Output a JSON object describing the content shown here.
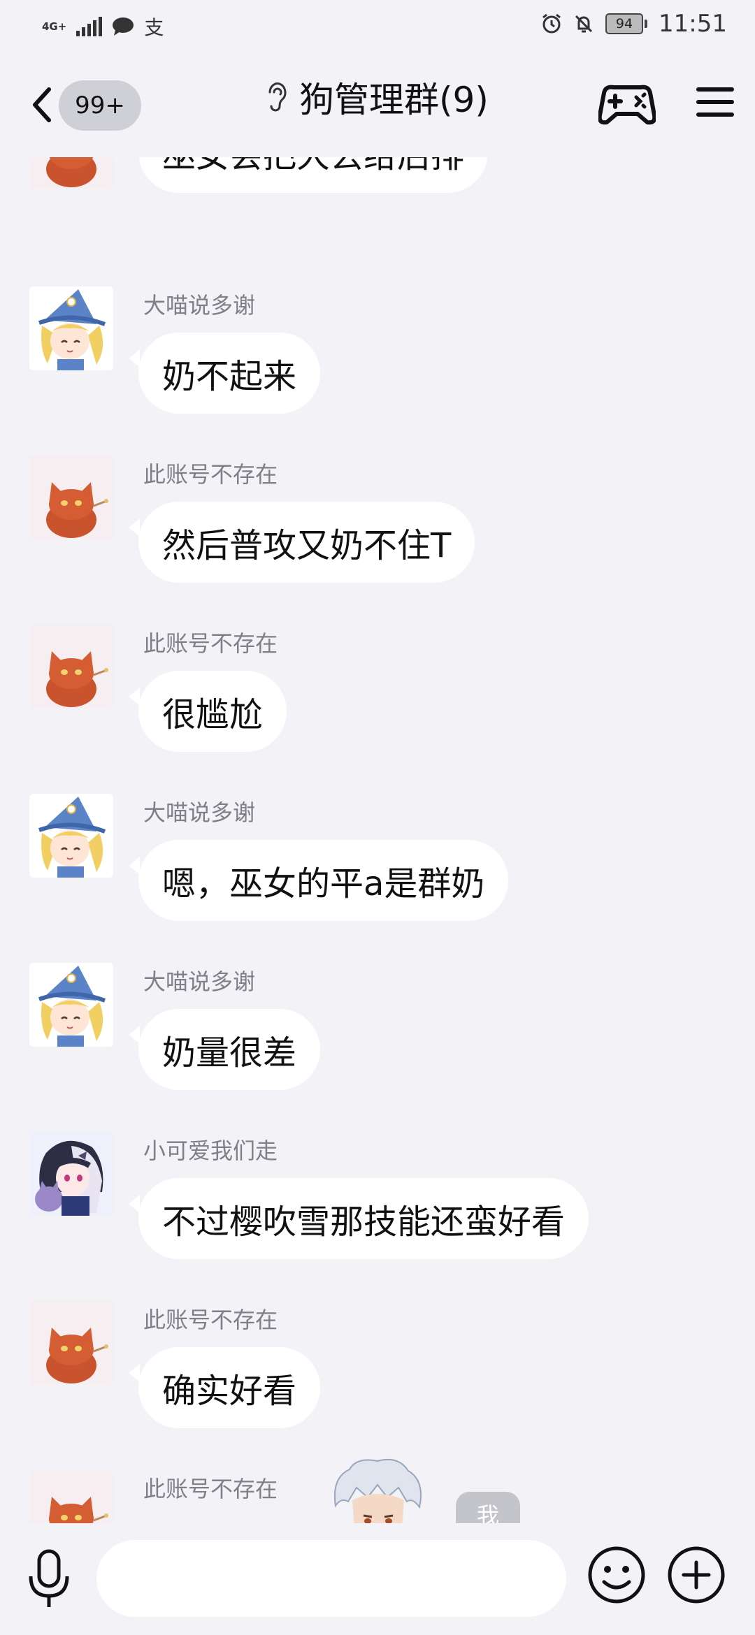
{
  "status_bar": {
    "network": "4G+",
    "carrier_icons": [
      "chat-bubble-icon",
      "alipay-icon"
    ],
    "alipay_glyph": "支",
    "battery": "94",
    "time": "11:51"
  },
  "header": {
    "unread_count": "99+",
    "title": "狗管理群(9)"
  },
  "messages": [
    {
      "sender": "",
      "text": "巫女会把大丢给后排",
      "avatar": "cat-avatar"
    },
    {
      "sender": "大喵说多谢",
      "text": "奶不起来",
      "avatar": "witch-avatar"
    },
    {
      "sender": "此账号不存在",
      "text": "然后普攻又奶不住T",
      "avatar": "cat-avatar"
    },
    {
      "sender": "此账号不存在",
      "text": "很尴尬",
      "avatar": "cat-avatar"
    },
    {
      "sender": "大喵说多谢",
      "text": "嗯，巫女的平a是群奶",
      "avatar": "witch-avatar"
    },
    {
      "sender": "大喵说多谢",
      "text": "奶量很差",
      "avatar": "witch-avatar"
    },
    {
      "sender": "小可爱我们走",
      "text": "不过樱吹雪那技能还蛮好看",
      "avatar": "anime-girl-avatar"
    },
    {
      "sender": "此账号不存在",
      "text": "确实好看",
      "avatar": "cat-avatar"
    },
    {
      "sender": "此账号不存在",
      "text": "",
      "avatar": "cat-avatar"
    }
  ],
  "overlay": {
    "me_label": "我"
  },
  "input": {
    "value": "",
    "placeholder": ""
  },
  "colors": {
    "background": "#f2f2f7",
    "bubble": "#ffffff",
    "sender_name": "#7f7f87",
    "badge": "#cfd0d6"
  }
}
